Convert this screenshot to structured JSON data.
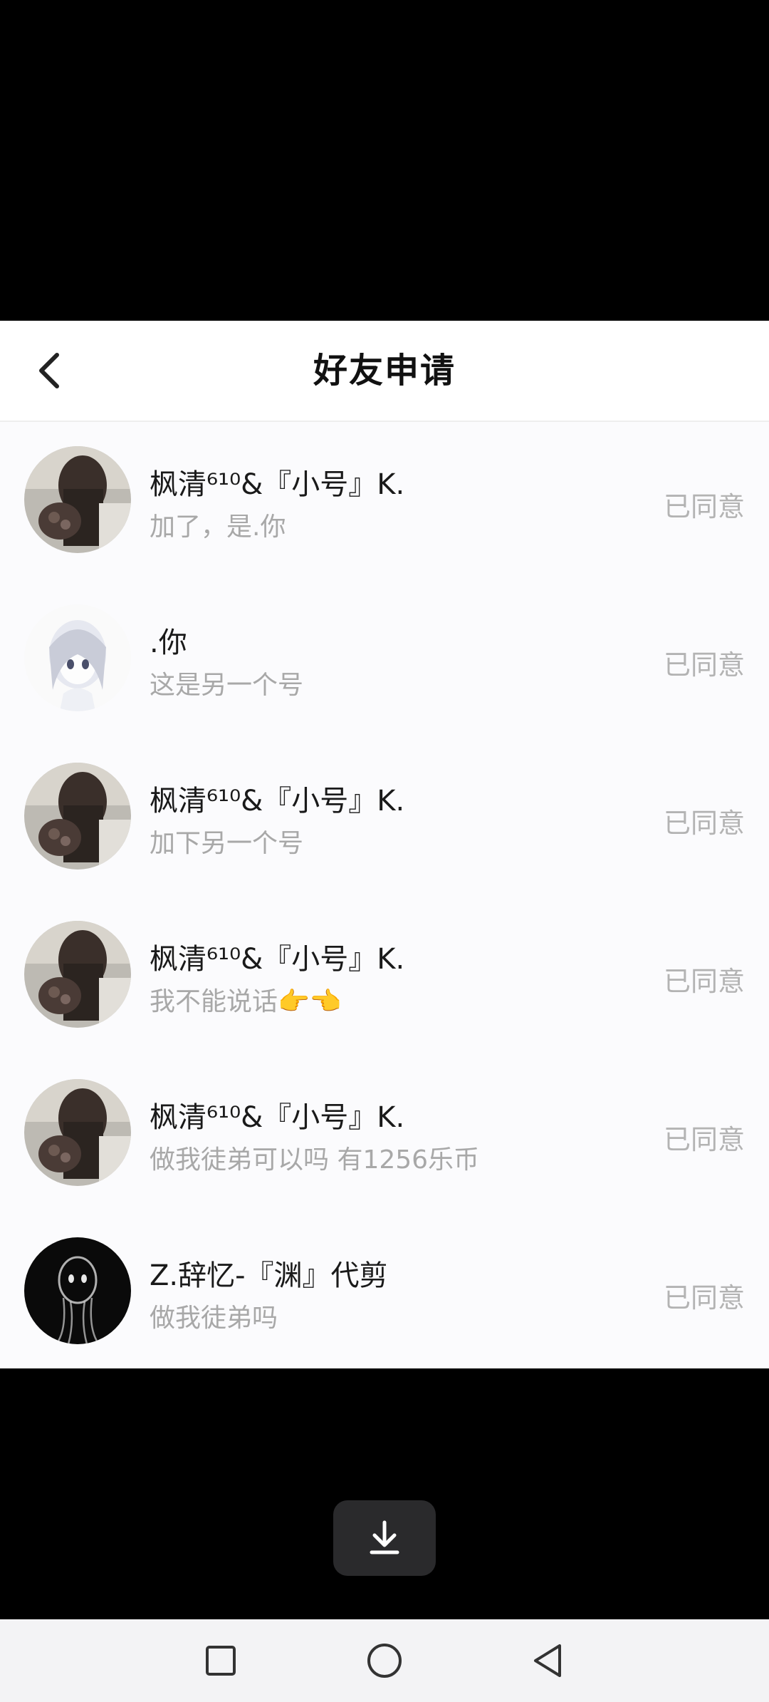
{
  "header": {
    "title": "好友申请",
    "back_icon": "chevron-left-icon"
  },
  "requests": [
    {
      "avatar": "girl-with-flowers-avatar",
      "name": "枫清⁶¹⁰&『小号』K.",
      "message": "加了，是.你",
      "status": "已同意"
    },
    {
      "avatar": "anime-girl-avatar",
      "name": ".你",
      "message": "这是另一个号",
      "status": "已同意"
    },
    {
      "avatar": "girl-with-flowers-avatar",
      "name": "枫清⁶¹⁰&『小号』K.",
      "message": "加下另一个号",
      "status": "已同意"
    },
    {
      "avatar": "girl-with-flowers-avatar",
      "name": "枫清⁶¹⁰&『小号』K.",
      "message": "我不能说话👉👈",
      "status": "已同意"
    },
    {
      "avatar": "girl-with-flowers-avatar",
      "name": "枫清⁶¹⁰&『小号』K.",
      "message": "做我徒弟可以吗 有1256乐币",
      "status": "已同意"
    },
    {
      "avatar": "ghost-figure-avatar",
      "name": "Z.辞忆-『渊』代剪",
      "message": "做我徒弟吗",
      "status": "已同意"
    }
  ],
  "overlay": {
    "download_icon": "download-icon"
  },
  "navbar": {
    "recent_icon": "square-recents-icon",
    "home_icon": "circle-home-icon",
    "back_icon": "triangle-back-icon"
  },
  "colors": {
    "status_text": "#b3b3b3",
    "message_text": "#a8a8a8",
    "name_text": "#1a1a1a"
  }
}
